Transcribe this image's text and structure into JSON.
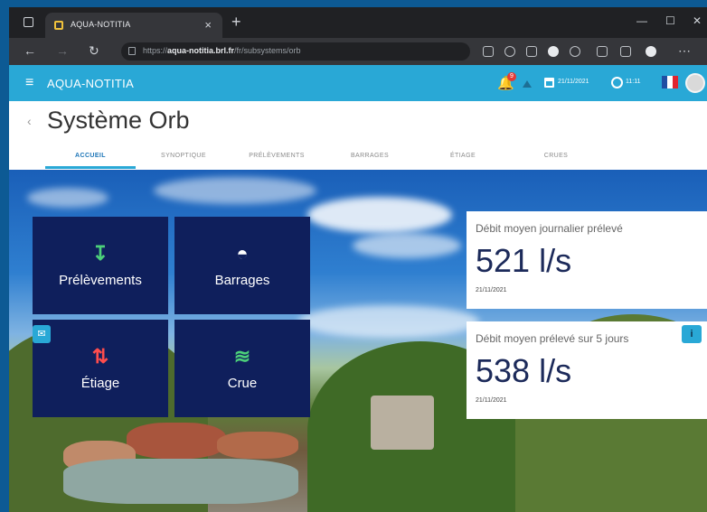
{
  "browser": {
    "tab_title": "AQUA-NOTITIA",
    "tab_close": "×",
    "new_tab": "+",
    "url_prefix": "https://",
    "url_host": "aqua-notitia.brl.fr",
    "url_path": "/fr/subsystems/orb",
    "minimize": "—",
    "maximize": "☐",
    "close": "✕"
  },
  "appbar": {
    "menu_icon": "≡",
    "title": "AQUA-NOTITIA",
    "notification_count": "9",
    "date": "21/11/2021",
    "time": "11:11",
    "flag_colors": [
      "#1f4fa3",
      "#ffffff",
      "#e0242f"
    ]
  },
  "page": {
    "back": "‹",
    "title": "Système Orb"
  },
  "tabs": [
    "ACCUEIL",
    "SYNOPTIQUE",
    "PRÉLÈVEMENTS",
    "BARRAGES",
    "ÉTIAGE",
    "CRUES"
  ],
  "tiles": [
    {
      "label": "Prélèvements",
      "icon": "↧",
      "color": "#4cd07a"
    },
    {
      "label": "Barrages",
      "icon": "◓",
      "color": "#ffffff"
    },
    {
      "label": "Étiage",
      "icon": "⇅",
      "color": "#ff4d4d"
    },
    {
      "label": "Crue",
      "icon": "≋",
      "color": "#4cd07a"
    }
  ],
  "stats": [
    {
      "label": "Débit moyen journalier prélevé",
      "value": "521 l/s",
      "date": "21/11/2021"
    },
    {
      "label": "Débit moyen prélevé sur 5 jours",
      "value": "538 l/s",
      "date": "21/11/2021"
    }
  ],
  "buttons": {
    "mail": "✉",
    "corner": "i"
  }
}
